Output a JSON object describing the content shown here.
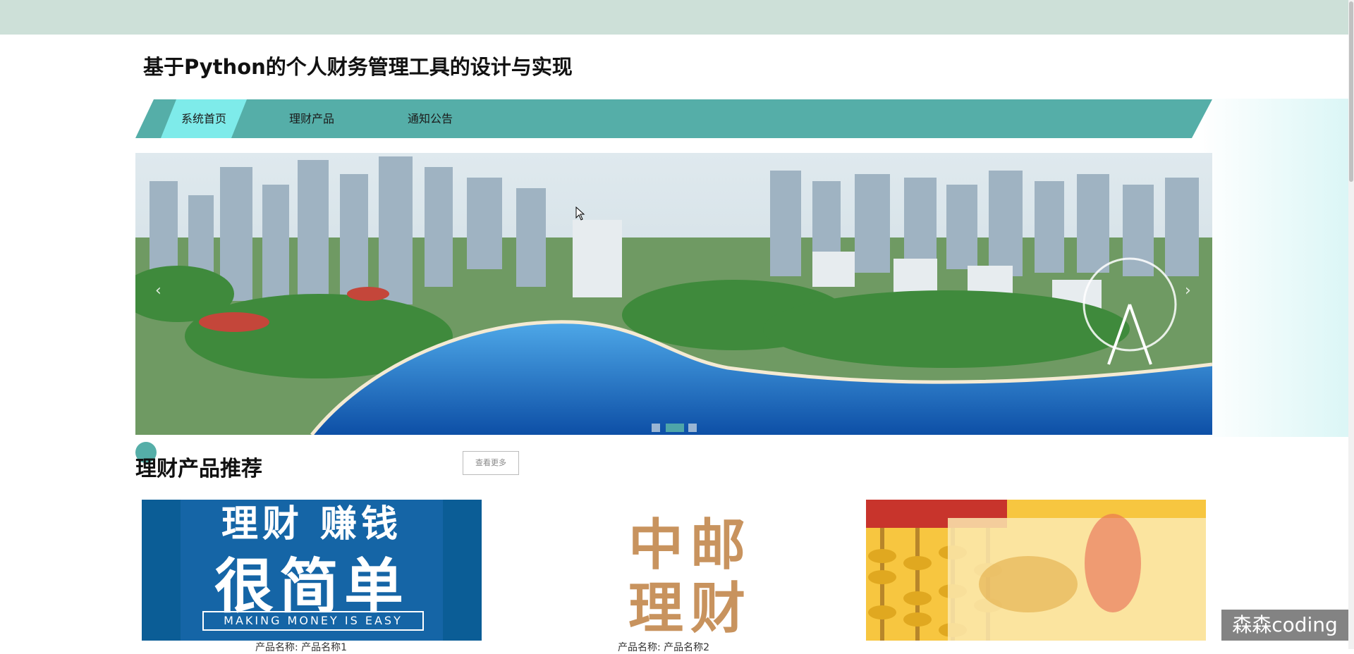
{
  "site": {
    "title": "基于Python的个人财务管理工具的设计与实现"
  },
  "nav": {
    "items": [
      {
        "label": "系统首页",
        "active": true
      },
      {
        "label": "理财产品",
        "active": false
      },
      {
        "label": "通知公告",
        "active": false
      }
    ]
  },
  "banner": {
    "slide_count": 3,
    "active_slide": 2,
    "prev_icon": "chevron-left-icon",
    "next_icon": "chevron-right-icon"
  },
  "products": {
    "title": "理财产品推荐",
    "more_label": "查看更多",
    "items": [
      {
        "image_text": [
          "理财 赚钱",
          "很简单",
          "MAKING MONEY IS EASY"
        ],
        "caption": "产品名称: 产品名称1"
      },
      {
        "image_text": [
          "中邮",
          "理财"
        ],
        "caption": "产品名称: 产品名称2"
      },
      {
        "image_text": [],
        "caption": ""
      }
    ]
  },
  "watermark": "森森coding",
  "colors": {
    "primary": "#55aea8",
    "nav_active": "#7eebea",
    "topbar": "#cde0d8"
  }
}
